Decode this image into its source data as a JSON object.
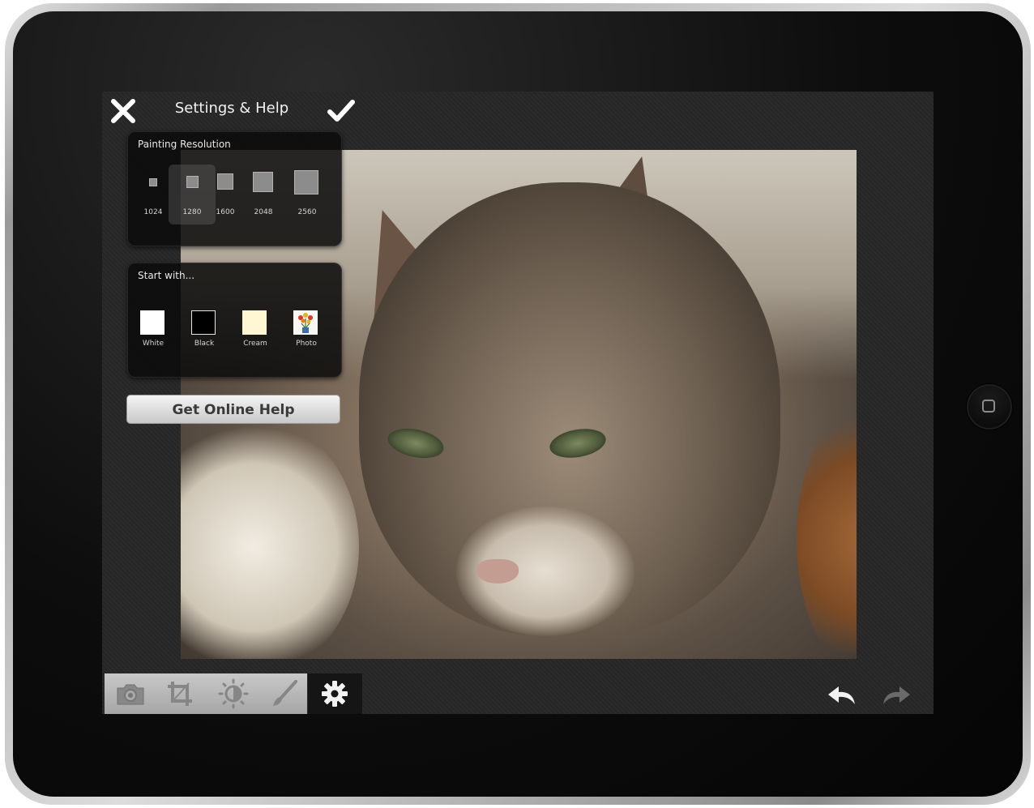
{
  "header": {
    "title": "Settings & Help",
    "close_icon": "close-icon",
    "done_icon": "checkmark-icon"
  },
  "painting_resolution": {
    "title": "Painting Resolution",
    "options": [
      "1024",
      "1280",
      "1600",
      "2048",
      "2560"
    ],
    "selected": "1280"
  },
  "start_with": {
    "title": "Start with...",
    "options": [
      {
        "label": "White",
        "color": "#ffffff"
      },
      {
        "label": "Black",
        "color": "#000000"
      },
      {
        "label": "Cream",
        "color": "#fff6d4"
      },
      {
        "label": "Photo",
        "icon": "flower-vase-thumbnail"
      }
    ]
  },
  "help_button": {
    "label": "Get Online Help"
  },
  "toolbar": {
    "tools": [
      "camera-icon",
      "crop-icon",
      "brightness-icon",
      "brush-icon",
      "gear-icon"
    ],
    "active_tool": "gear-icon",
    "undo_icon": "undo-icon",
    "redo_icon": "redo-icon"
  },
  "colors": {
    "panel_bg": "#0a0a0a",
    "help_button_text": "#3a3a3a",
    "toolbar_inactive": "#b5b5b5"
  }
}
